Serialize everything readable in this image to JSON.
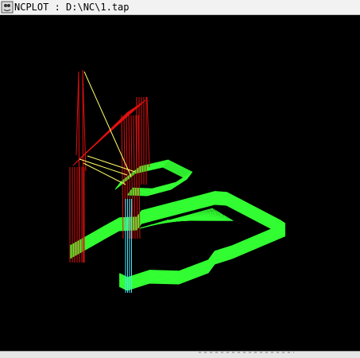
{
  "window": {
    "title": "NCPLOT : D:\\NC\\1.tap",
    "icon": "ncplot-app-icon"
  },
  "colors": {
    "background": "#000000",
    "rapid_moves": "#e01010",
    "feed_moves": "#33ff33",
    "plunge_moves": "#44e8ff",
    "arc_moves": "#ffff66"
  },
  "viewport": {
    "content": "toolpath-plot"
  }
}
